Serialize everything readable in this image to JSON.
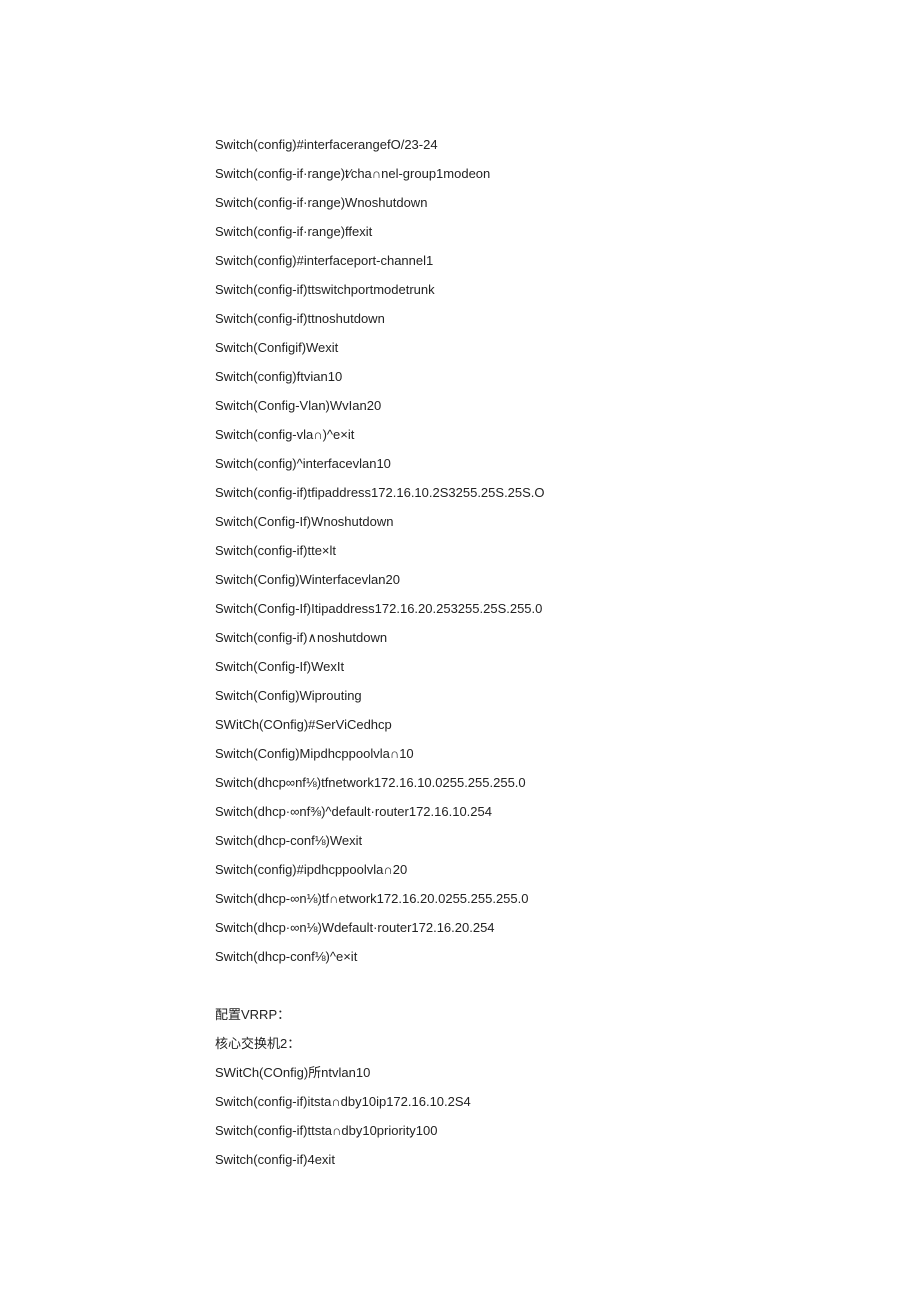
{
  "block1": [
    "Switch(config)#interfacerangefO/23-24",
    "Switch(config-if·range)t⁄cha∩nel-group1modeon",
    "Switch(config-if·range)Wnoshutdown",
    "Switch(config-if·range)ffexit",
    "Switch(config)#interfaceport-channel1",
    "Switch(config-if)ttswitchportmodetrunk",
    "Switch(config-if)ttnoshutdown",
    "Switch(Configif)Wexit",
    "Switch(config)ftvian10",
    "Switch(Config-Vlan)WvIan20",
    "Switch(config-vla∩)^e×it",
    "Switch(config)^interfacevlan10",
    "Switch(config-if)tfipaddress172.16.10.2S3255.25S.25S.O",
    "Switch(Config-If)Wnoshutdown",
    "Switch(config-if)tte×lt",
    "Switch(Config)Winterfacevlan20",
    "Switch(Config-If)Itipaddress172.16.20.253255.25S.255.0",
    "Switch(config-if)∧noshutdown",
    "Switch(Config-If)WexIt",
    "Switch(Config)Wiprouting",
    "SWitCh(COnfig)#SerViCedhcp",
    "Switch(Config)Mipdhcppoolvla∩10",
    "Switch(dhcp∞nf⅛)tfnetwork172.16.10.0255.255.255.0",
    "Switch(dhcp·∞nf⅜)^default·router172.16.10.254",
    "Switch(dhcp-conf⅛)Wexit",
    "Switch(config)#ipdhcppoolvla∩20",
    "Switch(dhcp-∞n⅛)tf∩etwork172.16.20.0255.255.255.0",
    "Switch(dhcp·∞n⅛)Wdefault·router172.16.20.254",
    "Switch(dhcp-conf⅛)^e×it"
  ],
  "block2": [
    "配置VRRP：",
    "核心交换机2：",
    "SWitCh(COnfig)所ntvlan10",
    "Switch(config-if)itsta∩dby10ip172.16.10.2S4",
    "Switch(config-if)ttsta∩dby10priority100",
    "Switch(config-if)4exit"
  ]
}
